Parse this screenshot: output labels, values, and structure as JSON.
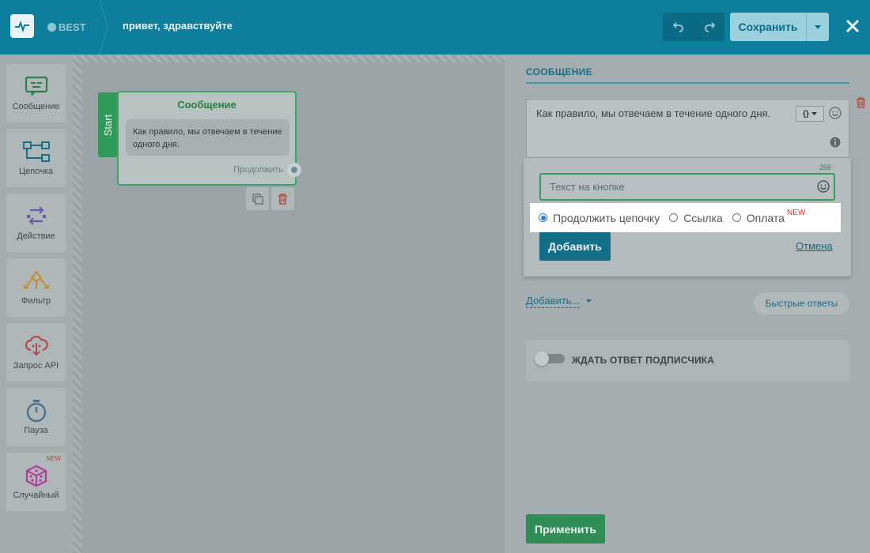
{
  "header": {
    "brand": "BEST",
    "flow_title": "привет, здравствуйте",
    "save_label": "Сохранить"
  },
  "toolbox": {
    "items": [
      {
        "label": "Сообщение",
        "icon": "message-icon",
        "color": "#2e7d4f"
      },
      {
        "label": "Цепочка",
        "icon": "chain-icon",
        "color": "#1a6e85"
      },
      {
        "label": "Действие",
        "icon": "action-icon",
        "color": "#6a5aa8"
      },
      {
        "label": "Фильтр",
        "icon": "filter-icon",
        "color": "#c88a2a"
      },
      {
        "label": "Запрос API",
        "icon": "cloud-api-icon",
        "color": "#b24a4a"
      },
      {
        "label": "Пауза",
        "icon": "timer-icon",
        "color": "#4f6f8f"
      },
      {
        "label": "Случайный",
        "icon": "dice-icon",
        "color": "#b23a9a",
        "badge": "NEW"
      }
    ]
  },
  "canvas": {
    "start_label": "Start",
    "node": {
      "title": "Сообщение",
      "text": "Как правило, мы отвечаем в течение одного дня.",
      "continue_label": "Продолжить"
    }
  },
  "panel": {
    "title": "СООБЩЕНИЕ",
    "message_text": "Как правило, мы отвечаем в течение одного дня.",
    "popover": {
      "char_count": "256",
      "input_placeholder": "Текст на кнопке",
      "radio_options": [
        {
          "label": "Продолжить цепочку",
          "selected": true
        },
        {
          "label": "Ссылка",
          "selected": false
        },
        {
          "label": "Оплата",
          "selected": false,
          "badge": "NEW"
        }
      ],
      "add_label": "Добавить",
      "cancel_label": "Отмена"
    },
    "add_menu_label": "Добавить...",
    "quick_replies_label": "Быстрые ответы",
    "wait_label": "ЖДАТЬ ОТВЕТ ПОДПИСЧИКА",
    "apply_label": "Применить"
  },
  "colors": {
    "header_bg": "#0d7f9c",
    "accent_green": "#3ea564",
    "link_blue": "#1a6e85"
  }
}
